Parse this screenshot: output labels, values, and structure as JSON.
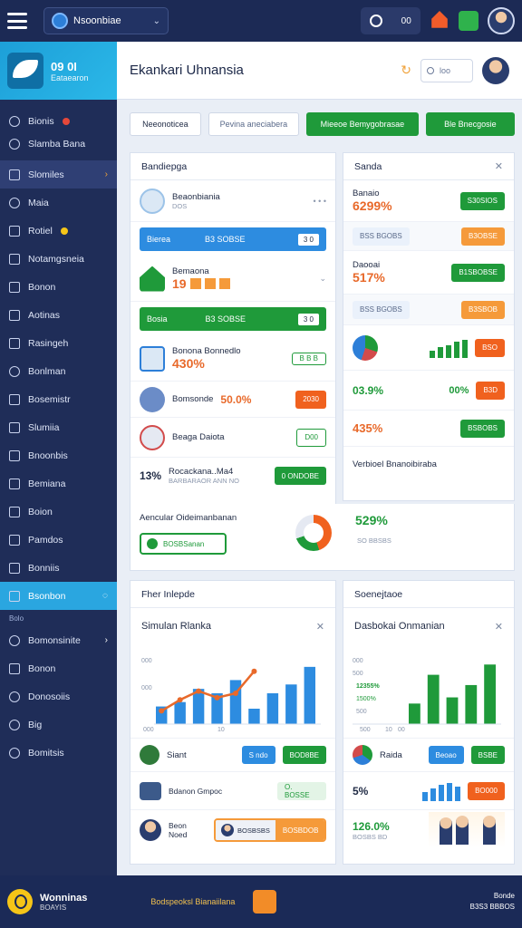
{
  "topbar": {
    "workspace": "Nsoonbiae",
    "time_label": "00"
  },
  "brand": {
    "title": "09 0I",
    "subtitle": "Eataearon"
  },
  "sidebar": {
    "items": [
      {
        "label": "Bionis",
        "icon": "chat-icon"
      },
      {
        "label": "Slamba Bana",
        "icon": "globe-icon"
      },
      {
        "label": "Slomiles",
        "icon": "square-icon"
      },
      {
        "label": "Maia",
        "icon": "gear-icon"
      },
      {
        "label": "Rotiel",
        "icon": "mail-icon"
      },
      {
        "label": "Notamgsneia",
        "icon": "chart-icon"
      },
      {
        "label": "Bonon",
        "icon": "card-icon"
      },
      {
        "label": "Aotinas",
        "icon": "doc-icon"
      },
      {
        "label": "Rasingeh",
        "icon": "list-icon"
      },
      {
        "label": "Bonlman",
        "icon": "user-icon"
      },
      {
        "label": "Bosemistr",
        "icon": "table-icon"
      },
      {
        "label": "Slumiia",
        "icon": "grid-icon"
      },
      {
        "label": "Bnoonbis",
        "icon": "folder-icon"
      },
      {
        "label": "Bemiana",
        "icon": "page-icon"
      },
      {
        "label": "Boion",
        "icon": "pen-icon"
      },
      {
        "label": "Pamdos",
        "icon": "image-icon"
      },
      {
        "label": "Bonniis",
        "icon": "box-icon"
      },
      {
        "label": "Bsonbon",
        "icon": "settings-icon"
      },
      {
        "label": "Bomonsinite",
        "icon": "globe-icon"
      },
      {
        "label": "Bonon",
        "icon": "book-icon"
      },
      {
        "label": "Donosoiis",
        "icon": "wheel-icon"
      },
      {
        "label": "Big",
        "icon": "person-icon"
      },
      {
        "label": "Bomitsis",
        "icon": "route-icon"
      }
    ],
    "section": "Bolo"
  },
  "header": {
    "title": "Ekankari Uhnansia",
    "search_placeholder": "loo"
  },
  "filters": [
    "Neeonoticea",
    "Pevina aneciabera",
    "Mieeoe Bemygobrasae",
    "Ble Bnecgosie"
  ],
  "panel_left": {
    "title": "Bandiepga",
    "rows": [
      {
        "name": "Beaonbiania",
        "sub": "DOS"
      },
      {
        "banner_label": "Bierea",
        "banner_value": "B3 SOBSE",
        "banner_tag": "3 0"
      },
      {
        "name": "Bemaona",
        "value": "19"
      },
      {
        "banner_label": "Bosia",
        "banner_value": "B3 SOBSE",
        "banner_tag": "3 0"
      },
      {
        "name": "Bonona Bonnedlo",
        "value": "430%"
      },
      {
        "name": "Bomsonde",
        "value": "50.0%",
        "chip": "2030"
      },
      {
        "name": "Beaga Daiota",
        "chip": "D00"
      },
      {
        "prefix": "13%",
        "name": "Rocackana..Ma4",
        "sub": "BARBARAOR ANN NO",
        "chip": "0 ONDOBE"
      }
    ]
  },
  "panel_right": {
    "title": "Sanda",
    "rows": [
      {
        "name": "Banaio",
        "value": "6299%",
        "chip": "S30SIOS"
      },
      {
        "sub": "BSS BGOBS",
        "chip": "B3OBSE"
      },
      {
        "name": "Daooai",
        "value": "517%",
        "chip": "B1SBOBSE"
      },
      {
        "sub": "BSS BGOBS",
        "chip": "B3SBOB"
      },
      {
        "chip": "BSO"
      },
      {
        "value": "03.9%",
        "value2": "00%",
        "chip": "B3D"
      },
      {
        "value": "435%",
        "chip": "BSBOBS"
      },
      {
        "name": "Verbioel Bnanoibiraba"
      }
    ]
  },
  "wide_row": {
    "label": "Aencular Oideimanbanan",
    "button": "BOSBSanan",
    "value": "529%",
    "sub": "SO BBSBS"
  },
  "panel_simulan": {
    "header": "Fher Inlepde",
    "title": "Simulan Rlanka",
    "y_ticks": [
      "000",
      "000"
    ],
    "x_ticks": [
      "000",
      "10"
    ],
    "rows": [
      {
        "name": "Siant",
        "chip1": "S ndo",
        "chip2": "BOD8BE"
      },
      {
        "name": "Bdanon Gmpoc",
        "chip": "O. BOSSE"
      },
      {
        "name": "Beon Noed",
        "sub": "BOSBSBS",
        "chip": "BOSBDOB"
      }
    ]
  },
  "panel_dasboki": {
    "header": "Soenejtaoe",
    "title": "Dasbokai Onmanian",
    "y_ticks": [
      "000",
      "500",
      "12355%",
      "1500%",
      "500"
    ],
    "x_ticks": [
      "500",
      "10",
      "00"
    ],
    "rows": [
      {
        "name": "Raida",
        "chip1": "Beoao",
        "chip2": "BSBE"
      },
      {
        "value": "5%",
        "chip": "BO000"
      },
      {
        "value": "126.0%",
        "sub": "BOSBS BD"
      }
    ]
  },
  "footer": {
    "brand": "Wonninas",
    "brand_sub": "BOAYIS",
    "mid": "Bodspeoksl Bianaiilana",
    "right1": "Bonde",
    "right2": "B3S3 BBBOS"
  },
  "chart_data": [
    {
      "type": "bar",
      "title": "Simulan Rlanka",
      "categories": [
        "1",
        "2",
        "3",
        "4",
        "5",
        "6",
        "7",
        "8",
        "9"
      ],
      "values": [
        8,
        10,
        16,
        14,
        20,
        7,
        14,
        18,
        26
      ],
      "line": [
        6,
        11,
        15,
        12,
        14,
        24,
        null,
        null,
        null
      ],
      "colors": {
        "bar": "#2d8ce0",
        "line": "#e8692a"
      }
    },
    {
      "type": "bar",
      "title": "Dasbokai Onmanian",
      "categories": [
        "1",
        "2",
        "3",
        "4",
        "5"
      ],
      "values": [
        10,
        24,
        13,
        19,
        29
      ],
      "colors": {
        "bar": "#1f9a3a"
      }
    }
  ]
}
